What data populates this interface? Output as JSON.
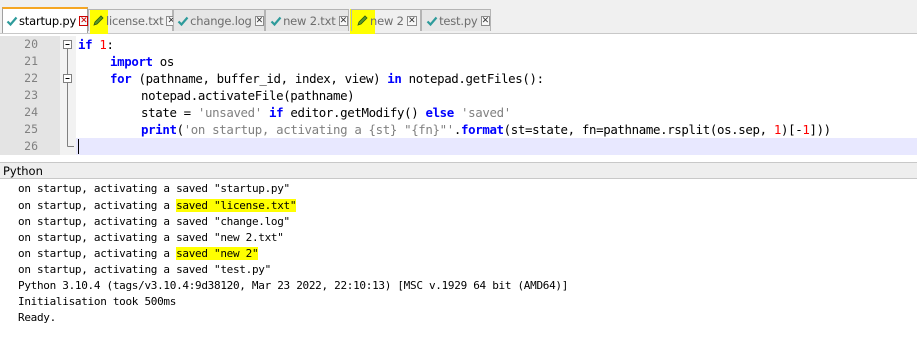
{
  "tabs": [
    {
      "label": "startup.py",
      "active": true,
      "icon": "check-icon",
      "highlighted": false
    },
    {
      "label": "license.txt",
      "active": false,
      "icon": "pencil-icon",
      "highlighted": true
    },
    {
      "label": "change.log",
      "active": false,
      "icon": "check-icon",
      "highlighted": false
    },
    {
      "label": "new 2.txt",
      "active": false,
      "icon": "check-icon",
      "highlighted": false
    },
    {
      "label": "new 2",
      "active": false,
      "icon": "pencil-icon",
      "highlighted": true
    },
    {
      "label": "test.py",
      "active": false,
      "icon": "check-icon",
      "highlighted": false
    }
  ],
  "editor": {
    "line_numbers": [
      "20",
      "21",
      "22",
      "23",
      "24",
      "25",
      "26"
    ],
    "code": {
      "l20_kw": "if",
      "l20_num": "1",
      "l20_rest": ":",
      "l21_kw": "import",
      "l21_rest": " os",
      "l22_kw1": "for",
      "l22_mid": " (pathname, buffer_id, index, view) ",
      "l22_kw2": "in",
      "l22_rest": " notepad.getFiles():",
      "l23": "notepad.activateFile(pathname)",
      "l24_pre": "state = ",
      "l24_str1": "'unsaved'",
      "l24_sp1": " ",
      "l24_kw1": "if",
      "l24_mid": " editor.getModify() ",
      "l24_kw2": "else",
      "l24_sp2": " ",
      "l24_str2": "'saved'",
      "l25_kw": "print",
      "l25_p1": "(",
      "l25_str": "'on startup, activating a {st} \"{fn}\"'",
      "l25_p2": ".",
      "l25_fmt": "format",
      "l25_p3": "(st=state, fn=pathname.rsplit(os.sep, ",
      "l25_n1": "1",
      "l25_p4": ")[-",
      "l25_n2": "1",
      "l25_p5": "]))"
    }
  },
  "console_title": "Python",
  "console_lines": [
    {
      "pre": "on startup, activating a ",
      "hl": "",
      "text": "saved \"startup.py\""
    },
    {
      "pre": "on startup, activating a ",
      "hl": "saved \"license.txt\"",
      "text": ""
    },
    {
      "pre": "on startup, activating a ",
      "hl": "",
      "text": "saved \"change.log\""
    },
    {
      "pre": "on startup, activating a ",
      "hl": "",
      "text": "saved \"new 2.txt\""
    },
    {
      "pre": "on startup, activating a ",
      "hl": "saved \"new 2\"",
      "text": ""
    },
    {
      "pre": "on startup, activating a ",
      "hl": "",
      "text": "saved \"test.py\""
    },
    {
      "pre": "Python 3.10.4 (tags/v3.10.4:9d38120, Mar 23 2022, 22:10:13) [MSC v.1929 64 bit (AMD64)]",
      "hl": "",
      "text": ""
    },
    {
      "pre": "Initialisation took 500ms",
      "hl": "",
      "text": ""
    },
    {
      "pre": "Ready.",
      "hl": "",
      "text": ""
    }
  ],
  "colors": {
    "highlight": "#ffff00",
    "keyword": "#0000ff",
    "number": "#ff0000",
    "string": "#808080",
    "saved_icon": "#2e9b9b",
    "unsaved_icon": "#5a9a2a",
    "active_tab_accent": "#f5a623"
  }
}
